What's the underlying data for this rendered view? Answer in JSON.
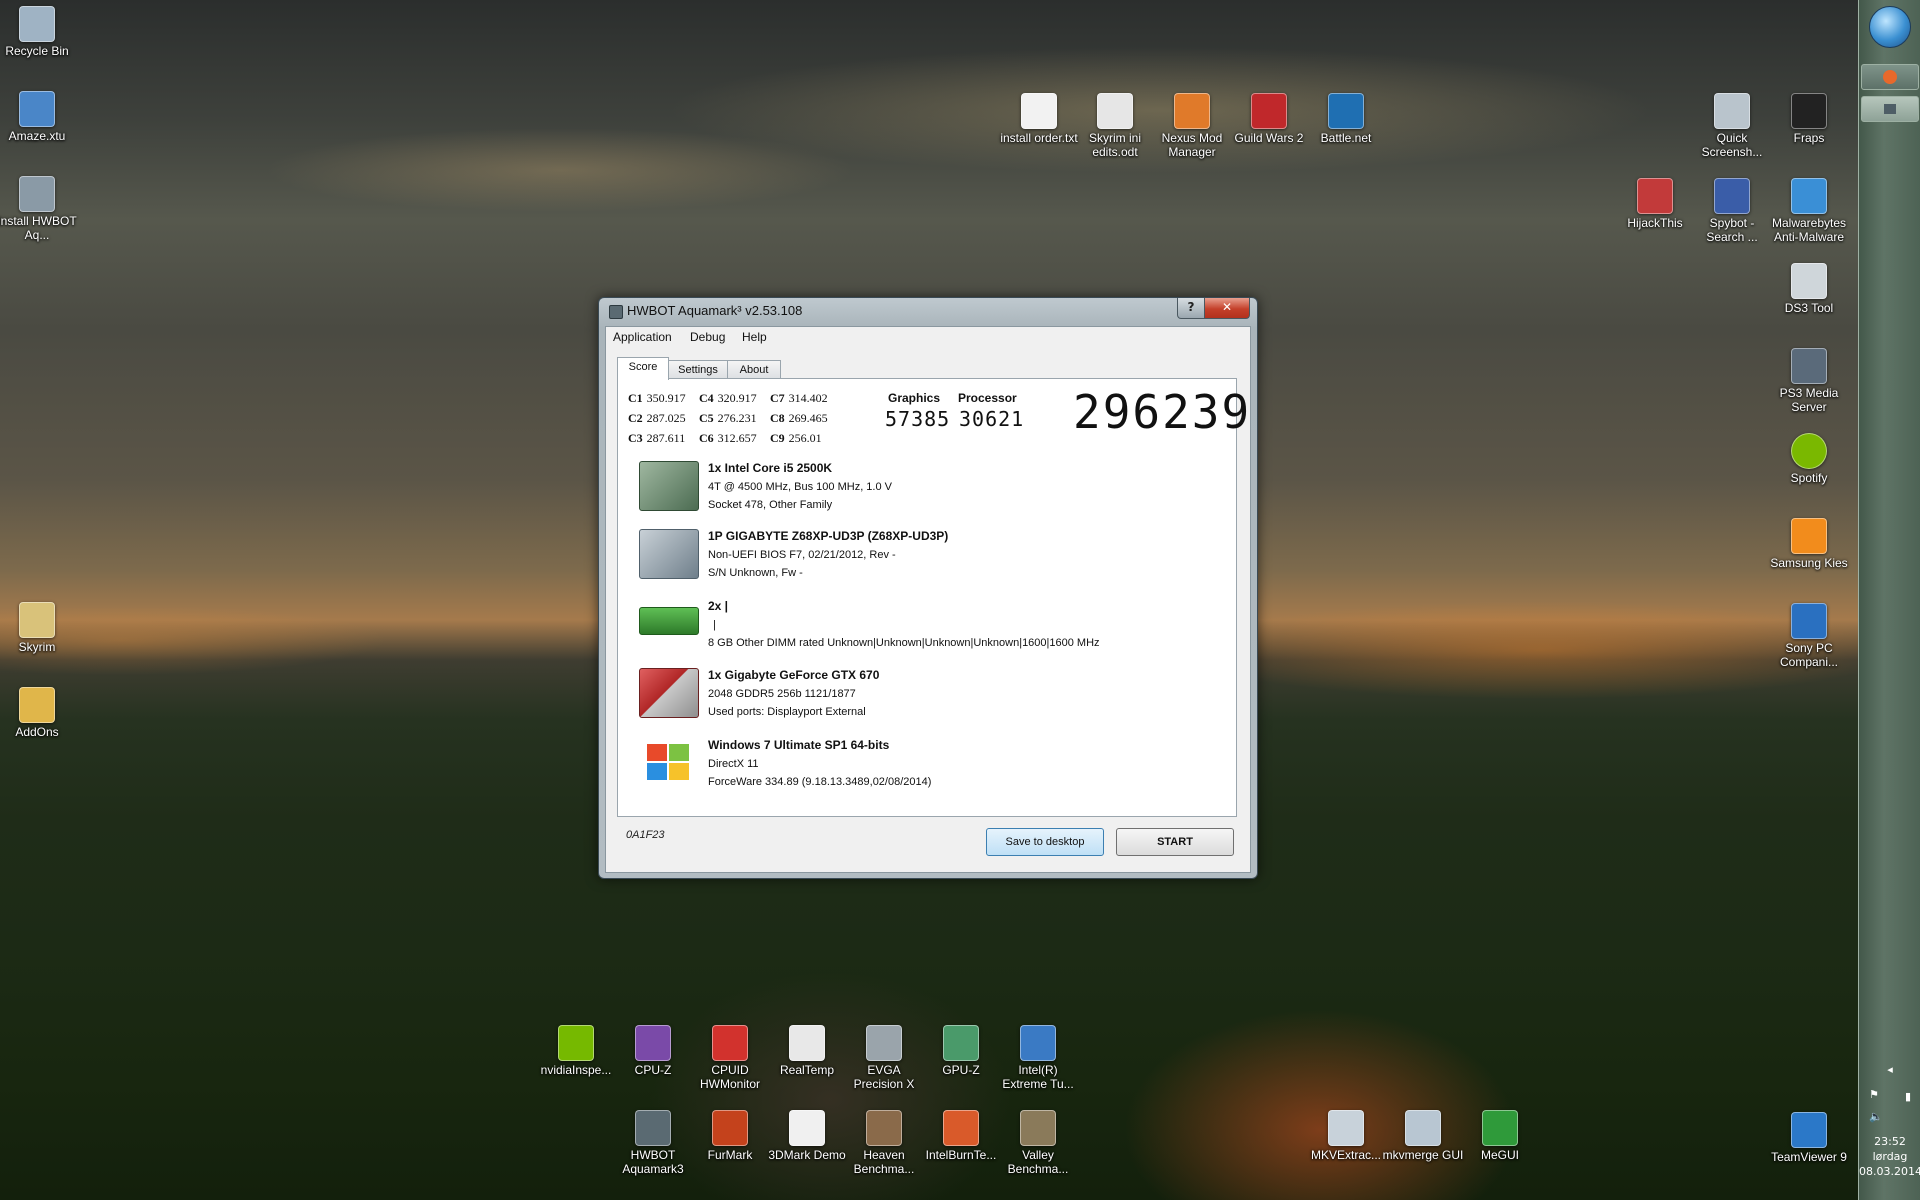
{
  "desktop_icons": [
    {
      "label": "Recycle Bin",
      "icon": "recycle-bin-icon",
      "color": "#9fb3c4"
    },
    {
      "label": "Amaze.xtu",
      "icon": "file-icon",
      "color": "#4a86c8"
    },
    {
      "label": "Install HWBOT Aq...",
      "icon": "installer-icon",
      "color": "#8a9aa6"
    },
    {
      "label": "Skyrim",
      "icon": "folder-icon",
      "color": "#d9c27a"
    },
    {
      "label": "AddOns",
      "icon": "folder-icon",
      "color": "#e0b64a"
    },
    {
      "label": "install order.txt",
      "icon": "text-file-icon",
      "color": "#f2f2f2"
    },
    {
      "label": "Skyrim ini edits.odt",
      "icon": "document-icon",
      "color": "#e6e6e6"
    },
    {
      "label": "Nexus Mod Manager",
      "icon": "nexus-icon",
      "color": "#e07a2a"
    },
    {
      "label": "Guild Wars 2",
      "icon": "guildwars-icon",
      "color": "#c0282b"
    },
    {
      "label": "Battle.net",
      "icon": "battlenet-icon",
      "color": "#1f6fb2"
    },
    {
      "label": "Quick Screensh...",
      "icon": "camera-icon",
      "color": "#b9c4cc"
    },
    {
      "label": "Fraps",
      "icon": "fraps-icon",
      "color": "#222222"
    },
    {
      "label": "HijackThis",
      "icon": "hijackthis-icon",
      "color": "#c23a3a"
    },
    {
      "label": "Spybot - Search ...",
      "icon": "spybot-icon",
      "color": "#3a5da8"
    },
    {
      "label": "Malwarebytes Anti-Malware",
      "icon": "malwarebytes-icon",
      "color": "#3a8fd6"
    },
    {
      "label": "DS3 Tool",
      "icon": "gamepad-icon",
      "color": "#cfd6da"
    },
    {
      "label": "PS3 Media Server",
      "icon": "media-server-icon",
      "color": "#5a6a7a"
    },
    {
      "label": "Spotify",
      "icon": "spotify-icon",
      "color": "#7ab800"
    },
    {
      "label": "Samsung Kies",
      "icon": "kies-icon",
      "color": "#f28c1c"
    },
    {
      "label": "Sony PC Compani...",
      "icon": "sony-icon",
      "color": "#2a70c0"
    },
    {
      "label": "TeamViewer 9",
      "icon": "teamviewer-icon",
      "color": "#2b78c8"
    },
    {
      "label": "nvidiaInspe...",
      "icon": "nvidia-icon",
      "color": "#76b900"
    },
    {
      "label": "CPU-Z",
      "icon": "cpuz-icon",
      "color": "#7a4aa8"
    },
    {
      "label": "CPUID HWMonitor",
      "icon": "hwmonitor-icon",
      "color": "#d2322d"
    },
    {
      "label": "RealTemp",
      "icon": "realtemp-icon",
      "color": "#e8e8e8"
    },
    {
      "label": "EVGA Precision X",
      "icon": "evga-icon",
      "color": "#9aa4ab"
    },
    {
      "label": "GPU-Z",
      "icon": "gpuz-icon",
      "color": "#4a9a6a"
    },
    {
      "label": "Intel(R) Extreme Tu...",
      "icon": "intel-xtu-icon",
      "color": "#3a7ac4"
    },
    {
      "label": "HWBOT Aquamark3",
      "icon": "hwbot-icon",
      "color": "#5a6a72"
    },
    {
      "label": "FurMark",
      "icon": "furmark-icon",
      "color": "#c4421c"
    },
    {
      "label": "3DMark Demo",
      "icon": "3dmark-icon",
      "color": "#f0f0f0"
    },
    {
      "label": "Heaven Benchma...",
      "icon": "heaven-icon",
      "color": "#8a6a4a"
    },
    {
      "label": "IntelBurnTe...",
      "icon": "intelburntest-icon",
      "color": "#d95a2a"
    },
    {
      "label": "Valley Benchma...",
      "icon": "valley-icon",
      "color": "#8a7a5a"
    },
    {
      "label": "MKVExtrac...",
      "icon": "mkvextract-icon",
      "color": "#c8d2da"
    },
    {
      "label": "mkvmerge GUI",
      "icon": "mkvmerge-icon",
      "color": "#b8c6d2"
    },
    {
      "label": "MeGUI",
      "icon": "megui-icon",
      "color": "#2f9a3a"
    }
  ],
  "window": {
    "title": "HWBOT Aquamark³ v2.53.108",
    "help_btn": "?",
    "close_btn": "✕",
    "menu": [
      "Application",
      "Debug",
      "Help"
    ],
    "tabs": [
      "Score",
      "Settings",
      "About"
    ],
    "active_tab": "Score",
    "clocks": [
      {
        "name": "C1",
        "value": "350.917"
      },
      {
        "name": "C2",
        "value": "287.025"
      },
      {
        "name": "C3",
        "value": "287.611"
      },
      {
        "name": "C4",
        "value": "320.917"
      },
      {
        "name": "C5",
        "value": "276.231"
      },
      {
        "name": "C6",
        "value": "312.657"
      },
      {
        "name": "C7",
        "value": "314.402"
      },
      {
        "name": "C8",
        "value": "269.465"
      },
      {
        "name": "C9",
        "value": "256.01"
      }
    ],
    "graphics_label": "Graphics",
    "graphics_score": "57385",
    "processor_label": "Processor",
    "processor_score": "30621",
    "total_score": "296239",
    "hardware": [
      {
        "icon": "cpu-chip-icon",
        "title": "1x Intel Core i5 2500K",
        "line1": "4T @ 4500 MHz, Bus 100 MHz, 1.0 V",
        "line2": "Socket 478, Other Family"
      },
      {
        "icon": "motherboard-icon",
        "title": "1P GIGABYTE Z68XP-UD3P (Z68XP-UD3P)",
        "line1": "Non-UEFI BIOS F7, 02/21/2012, Rev -",
        "line2": "S/N Unknown, Fw -"
      },
      {
        "icon": "ram-module-icon",
        "title": "2x |",
        "line1": "|",
        "line2": "8 GB Other DIMM rated Unknown|Unknown|Unknown|Unknown|1600|1600 MHz"
      },
      {
        "icon": "graphics-card-icon",
        "title": "1x Gigabyte GeForce GTX 670",
        "line1": "2048 GDDR5 256b 1121/1877",
        "line2": "Used ports: Displayport External"
      },
      {
        "icon": "windows-logo-icon",
        "title": "Windows 7 Ultimate SP1 64-bits",
        "line1": "DirectX 11",
        "line2": "ForceWare 334.89 (9.18.13.3489,02/08/2014)"
      }
    ],
    "code": "0A1F23",
    "save_button": "Save to desktop",
    "start_button": "START"
  },
  "taskbar": {
    "time": "23:52",
    "day": "lørdag",
    "date": "08.03.2014"
  }
}
